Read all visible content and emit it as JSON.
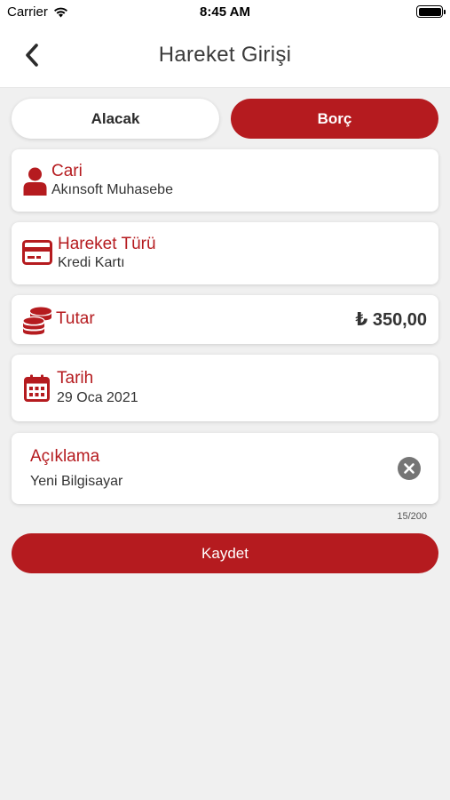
{
  "status_bar": {
    "carrier": "Carrier",
    "time": "8:45 AM"
  },
  "header": {
    "title": "Hareket Girişi"
  },
  "segments": {
    "left_label": "Alacak",
    "right_label": "Borç",
    "selected": "Borç"
  },
  "form": {
    "cari": {
      "label": "Cari",
      "value": "Akınsoft Muhasebe",
      "icon": "user-icon"
    },
    "hareket_turu": {
      "label": "Hareket Türü",
      "value": "Kredi Kartı",
      "icon": "credit-card-icon"
    },
    "tutar": {
      "label": "Tutar",
      "value": "₺ 350,00",
      "icon": "coins-icon"
    },
    "tarih": {
      "label": "Tarih",
      "value": "29 Oca 2021",
      "icon": "calendar-icon"
    },
    "aciklama": {
      "label": "Açıklama",
      "value": "Yeni Bilgisayar",
      "counter": "15/200",
      "clear_icon": "clear-icon"
    }
  },
  "actions": {
    "save_label": "Kaydet"
  },
  "colors": {
    "accent": "#b51b1f",
    "background": "#f0f0f0",
    "card": "#ffffff"
  }
}
